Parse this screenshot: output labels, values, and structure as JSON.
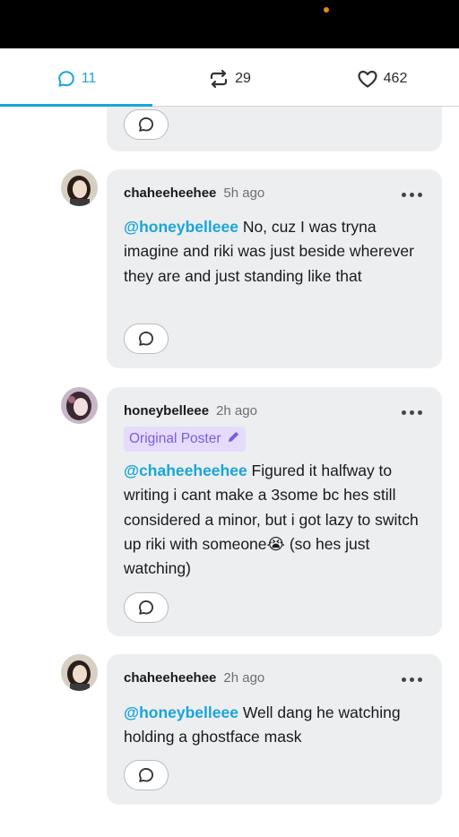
{
  "colors": {
    "accent": "#1aa5d8",
    "card_bg": "#eceef0",
    "op_badge_bg": "#e6dbfb",
    "op_badge_text": "#7c5ce0"
  },
  "tabs": [
    {
      "icon": "speech-bubble-icon",
      "count": "11",
      "active": true
    },
    {
      "icon": "reblog-icon",
      "count": "29",
      "active": false
    },
    {
      "icon": "heart-icon",
      "count": "462",
      "active": false
    }
  ],
  "comments": [
    {
      "username": "chaheeheehee",
      "time": "5h ago",
      "mention": "@honeybelleee",
      "text": " No, cuz I was tryna imagine and riki was just beside wherever they are and just standing like that"
    },
    {
      "username": "honeybelleee",
      "time": "2h ago",
      "badge": "Original Poster",
      "mention": "@chaheeheehee",
      "text": " Figured it halfway to writing i cant make a 3some bc hes still considered a minor, but i got lazy to switch up riki with someone",
      "emoji": "😭",
      "text_after": " (so hes just watching)"
    },
    {
      "username": "chaheeheehee",
      "time": "2h ago",
      "mention": "@honeybelleee",
      "text": " Well dang he watching holding a ghostface mask"
    }
  ]
}
